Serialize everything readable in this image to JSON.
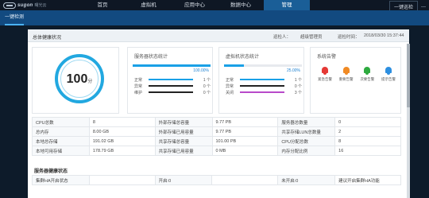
{
  "brand": {
    "name": "sugon",
    "sub": "曙光云"
  },
  "nav": {
    "items": [
      {
        "label": "首页",
        "active": false
      },
      {
        "label": "虚拟机",
        "active": false
      },
      {
        "label": "应用中心",
        "active": false
      },
      {
        "label": "数据中心",
        "active": false
      },
      {
        "label": "管理",
        "active": true
      }
    ],
    "user": "一键巡检",
    "extra": "—"
  },
  "subnav": {
    "tab": "一键检测"
  },
  "header": {
    "title": "总体健康状况",
    "inspector_label": "巡检人：",
    "inspector_value": "超级管理员",
    "time_label": "巡检时间：",
    "time_value": "2018/03/30 15:37:44"
  },
  "score": {
    "value": "100",
    "unit": "分"
  },
  "host_status": {
    "title": "服务器状态统计",
    "percent_label": "100.00%",
    "percent": 1.0,
    "rows": [
      {
        "label": "正常",
        "value": "1 个",
        "color": "#1aa0e6"
      },
      {
        "label": "异常",
        "value": "0 个",
        "color": "#222222"
      },
      {
        "label": "维护",
        "value": "0 个",
        "color": "#222222"
      }
    ]
  },
  "vm_status": {
    "title": "虚拟机状态统计",
    "percent_label": "25.00%",
    "percent": 0.25,
    "rows": [
      {
        "label": "正常",
        "value": "1 个",
        "color": "#1aa0e6"
      },
      {
        "label": "异常",
        "value": "0 个",
        "color": "#222222"
      },
      {
        "label": "关闭",
        "value": "3 个",
        "color": "#b84ac9"
      }
    ]
  },
  "alarms": {
    "title": "系统告警",
    "items": [
      {
        "label": "紧急告警",
        "color": "#e53935",
        "icon": "bell-icon"
      },
      {
        "label": "重要告警",
        "color": "#f08a24",
        "icon": "bell-icon"
      },
      {
        "label": "次要告警",
        "color": "#2eaa3f",
        "icon": "bell-icon"
      },
      {
        "label": "提示告警",
        "color": "#2d8fe0",
        "icon": "bell-icon"
      }
    ]
  },
  "info_rows": [
    [
      "CPU总数",
      "8",
      "外部存储总容量",
      "9.77 PB",
      "服务器总数量",
      "0"
    ],
    [
      "总内存",
      "8.00 GB",
      "外部存储已用容量",
      "9.77 PB",
      "共享存储LUN总数量",
      "2"
    ],
    [
      "本地总存储",
      "191.02 GB",
      "共享存储总容量",
      "101.00 PB",
      "CPU分配总数",
      "8"
    ],
    [
      "本地可用存储",
      "178.79 GB",
      "共享存储已用容量",
      "0 MB",
      "内存分配比例",
      "16"
    ]
  ],
  "host_section": {
    "title": "服务器健康状态",
    "rows": [
      [
        "集群HA开启状态",
        "",
        "开启:0",
        "",
        "未开启:0",
        "建议开启集群HA功能"
      ]
    ]
  }
}
